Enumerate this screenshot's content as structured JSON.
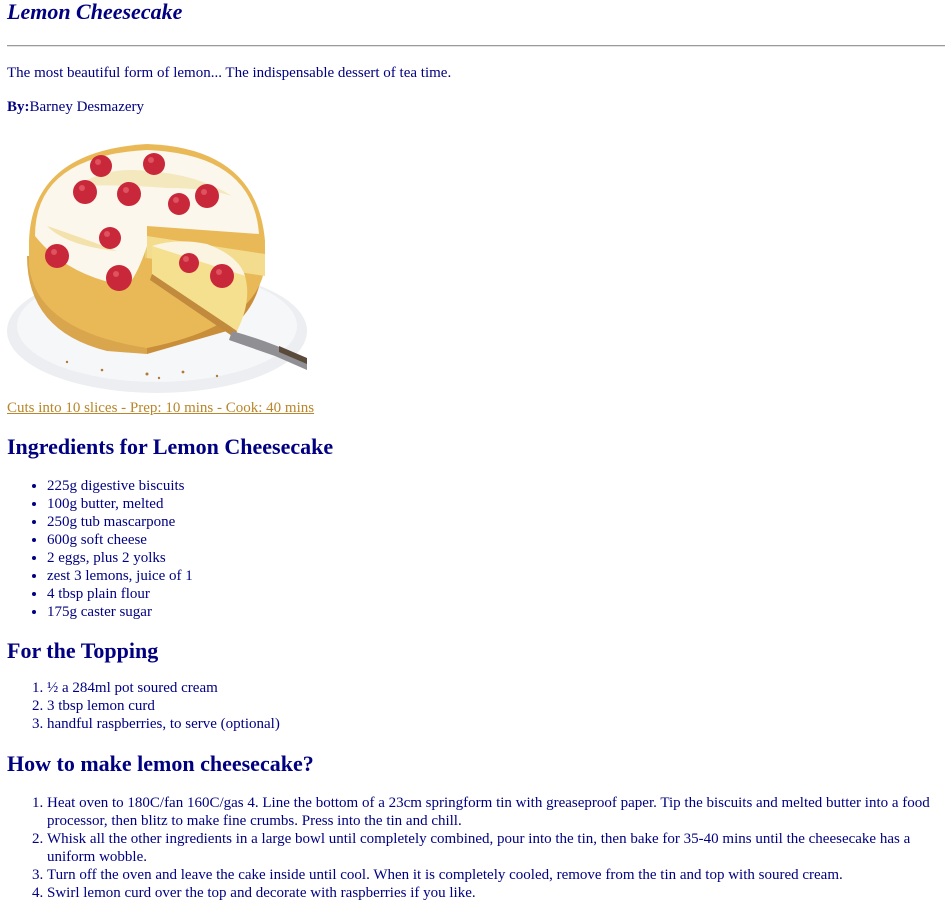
{
  "recipe": {
    "title": "Lemon Cheesecake",
    "tagline": "The most beautiful form of lemon... The indispensable dessert of tea time.",
    "by_label": "By:",
    "author": "Barney Desmazery",
    "meta_link": "Cuts into 10 slices - Prep: 10 mins - Cook: 40 mins"
  },
  "ingredients": {
    "heading": "Ingredients for Lemon Cheesecake",
    "items": [
      "225g digestive biscuits",
      "100g butter, melted",
      "250g tub mascarpone",
      "600g soft cheese",
      "2 eggs, plus 2 yolks",
      "zest 3 lemons, juice of 1",
      "4 tbsp plain flour",
      "175g caster sugar"
    ]
  },
  "topping": {
    "heading": "For the Topping",
    "items": [
      "½ a 284ml pot soured cream",
      "3 tbsp lemon curd",
      "handful raspberries, to serve (optional)"
    ]
  },
  "method": {
    "heading": "How to make lemon cheesecake?",
    "steps": [
      "Heat oven to 180C/fan 160C/gas 4. Line the bottom of a 23cm springform tin with greaseproof paper. Tip the biscuits and melted butter into a food processor, then blitz to make fine crumbs. Press into the tin and chill.",
      "Whisk all the other ingredients in a large bowl until completely combined, pour into the tin, then bake for 35-40 mins until the cheesecake has a uniform wobble.",
      "Turn off the oven and leave the cake inside until cool. When it is completely cooled, remove from the tin and top with soured cream.",
      "Swirl lemon curd over the top and decorate with raspberries if you like."
    ]
  }
}
